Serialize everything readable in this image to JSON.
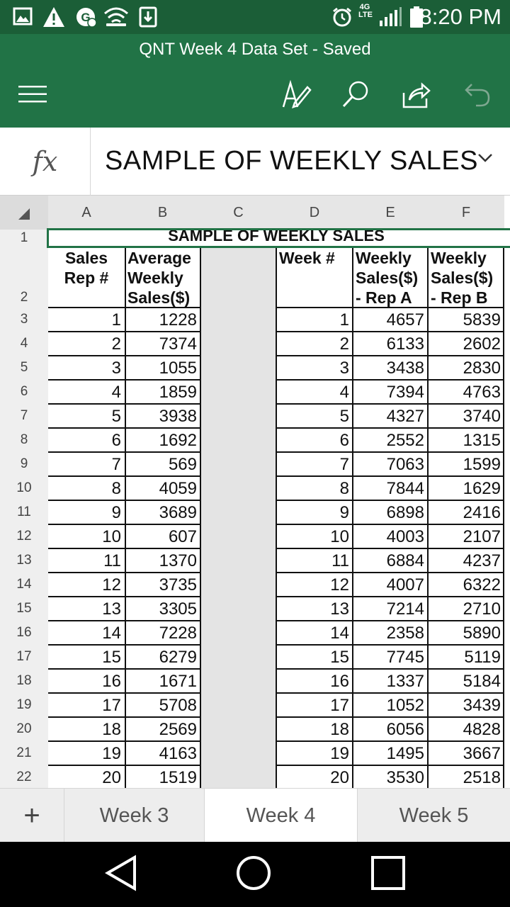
{
  "status_bar": {
    "time": "8:20 PM",
    "network_label": "4G LTE",
    "icons": [
      "image-icon",
      "warning-icon",
      "g-notification-icon",
      "wifi-icon",
      "download-icon",
      "alarm-icon",
      "signal-icon",
      "battery-icon"
    ]
  },
  "app_header": {
    "document_title": "QNT Week 4 Data Set - Saved",
    "buttons": [
      "menu-icon",
      "edit-pen-icon",
      "search-icon",
      "share-icon",
      "undo-icon"
    ]
  },
  "formula_bar": {
    "fx_label": "fx",
    "content": "SAMPLE OF WEEKLY SALES"
  },
  "sheet": {
    "columns": [
      "A",
      "B",
      "C",
      "D",
      "E",
      "F"
    ],
    "title_cell": "SAMPLE OF WEEKLY SALES",
    "headers": {
      "a": "Sales Rep  #",
      "b": "Average Weekly Sales($)",
      "d": "Week #",
      "e": "Weekly Sales($) - Rep A",
      "f": "Weekly Sales($) - Rep B"
    },
    "row_numbers": [
      "1",
      "2",
      "3",
      "4",
      "5",
      "6",
      "7",
      "8",
      "9",
      "10",
      "11",
      "12",
      "13",
      "14",
      "15",
      "16",
      "17",
      "18",
      "19",
      "20",
      "21",
      "22"
    ],
    "rows": [
      {
        "a": "1",
        "b": "1228",
        "d": "1",
        "e": "4657",
        "f": "5839"
      },
      {
        "a": "2",
        "b": "7374",
        "d": "2",
        "e": "6133",
        "f": "2602"
      },
      {
        "a": "3",
        "b": "1055",
        "d": "3",
        "e": "3438",
        "f": "2830"
      },
      {
        "a": "4",
        "b": "1859",
        "d": "4",
        "e": "7394",
        "f": "4763"
      },
      {
        "a": "5",
        "b": "3938",
        "d": "5",
        "e": "4327",
        "f": "3740"
      },
      {
        "a": "6",
        "b": "1692",
        "d": "6",
        "e": "2552",
        "f": "1315"
      },
      {
        "a": "7",
        "b": "569",
        "d": "7",
        "e": "7063",
        "f": "1599"
      },
      {
        "a": "8",
        "b": "4059",
        "d": "8",
        "e": "7844",
        "f": "1629"
      },
      {
        "a": "9",
        "b": "3689",
        "d": "9",
        "e": "6898",
        "f": "2416"
      },
      {
        "a": "10",
        "b": "607",
        "d": "10",
        "e": "4003",
        "f": "2107"
      },
      {
        "a": "11",
        "b": "1370",
        "d": "11",
        "e": "6884",
        "f": "4237"
      },
      {
        "a": "12",
        "b": "3735",
        "d": "12",
        "e": "4007",
        "f": "6322"
      },
      {
        "a": "13",
        "b": "3305",
        "d": "13",
        "e": "7214",
        "f": "2710"
      },
      {
        "a": "14",
        "b": "7228",
        "d": "14",
        "e": "2358",
        "f": "5890"
      },
      {
        "a": "15",
        "b": "6279",
        "d": "15",
        "e": "7745",
        "f": "5119"
      },
      {
        "a": "16",
        "b": "1671",
        "d": "16",
        "e": "1337",
        "f": "5184"
      },
      {
        "a": "17",
        "b": "5708",
        "d": "17",
        "e": "1052",
        "f": "3439"
      },
      {
        "a": "18",
        "b": "2569",
        "d": "18",
        "e": "6056",
        "f": "4828"
      },
      {
        "a": "19",
        "b": "4163",
        "d": "19",
        "e": "1495",
        "f": "3667"
      },
      {
        "a": "20",
        "b": "1519",
        "d": "20",
        "e": "3530",
        "f": "2518"
      }
    ]
  },
  "sheet_tabs": {
    "add_label": "+",
    "tabs": [
      "Week 3",
      "Week 4",
      "Week 5"
    ],
    "active": "Week 4"
  },
  "nav_bar": {
    "buttons": [
      "back-icon",
      "home-icon",
      "recents-icon"
    ]
  },
  "colors": {
    "header_green": "#217346",
    "status_green": "#1b5e37",
    "selection_border": "#217346"
  }
}
